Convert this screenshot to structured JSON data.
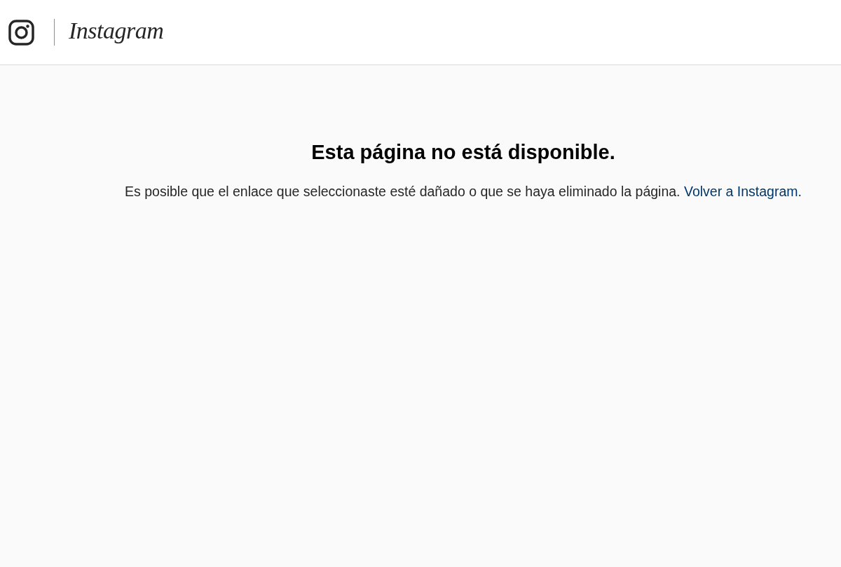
{
  "header": {
    "logo_text": "Instagram"
  },
  "error": {
    "title": "Esta página no está disponible.",
    "message": "Es posible que el enlace que seleccionaste esté dañado o que se haya eliminado la página.",
    "link": "Volver a Instagram."
  }
}
